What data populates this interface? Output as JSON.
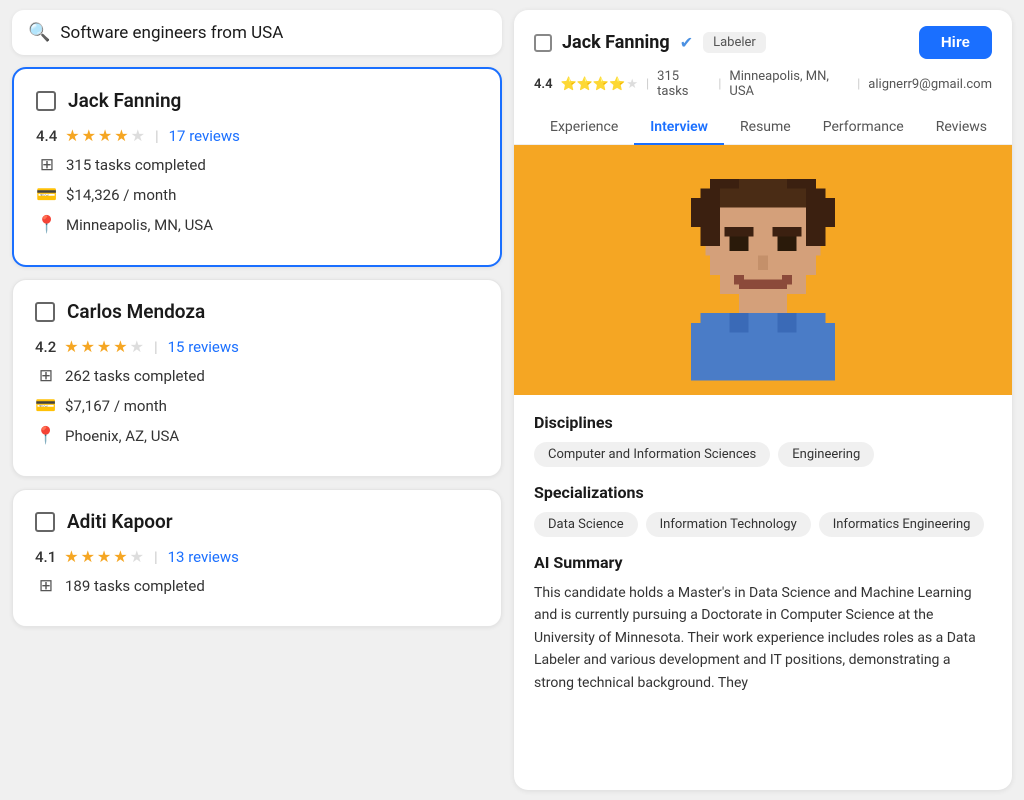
{
  "search": {
    "placeholder": "Software engineers from USA",
    "icon": "🔍"
  },
  "candidates": [
    {
      "id": "jack-fanning",
      "name": "Jack Fanning",
      "rating": 4.4,
      "stars": [
        1,
        1,
        1,
        1,
        0
      ],
      "reviews": 17,
      "reviews_label": "17 reviews",
      "tasks": "315 tasks completed",
      "salary": "$14,326 / month",
      "location": "Minneapolis, MN, USA",
      "selected": true
    },
    {
      "id": "carlos-mendoza",
      "name": "Carlos Mendoza",
      "rating": 4.2,
      "stars": [
        1,
        1,
        1,
        1,
        0
      ],
      "reviews": 15,
      "reviews_label": "15 reviews",
      "tasks": "262 tasks completed",
      "salary": "$7,167 / month",
      "location": "Phoenix, AZ, USA",
      "selected": false
    },
    {
      "id": "aditi-kapoor",
      "name": "Aditi Kapoor",
      "rating": 4.1,
      "stars": [
        1,
        1,
        1,
        1,
        0
      ],
      "reviews": 13,
      "reviews_label": "13 reviews",
      "tasks": "189 tasks completed",
      "salary": "",
      "location": "",
      "selected": false
    }
  ],
  "profile": {
    "name": "Jack Fanning",
    "badge": "Labeler",
    "hire_label": "Hire",
    "rating": "4.4",
    "stars": [
      1,
      1,
      1,
      1,
      0
    ],
    "tasks": "315 tasks",
    "location": "Minneapolis, MN, USA",
    "email": "alignerr9@gmail.com",
    "tabs": [
      "Experience",
      "Interview",
      "Resume",
      "Performance",
      "Reviews"
    ],
    "active_tab": "Interview",
    "disciplines": [
      "Computer and Information Sciences",
      "Engineering"
    ],
    "specializations": [
      "Data Science",
      "Information Technology",
      "Informatics Engineering"
    ],
    "ai_summary_title": "AI Summary",
    "ai_summary": "This candidate holds a Master's in Data Science and Machine Learning and is currently pursuing a Doctorate in Computer Science at the University of Minnesota. Their work experience includes roles as a Data Labeler and various development and IT positions, demonstrating a strong technical background. They"
  }
}
